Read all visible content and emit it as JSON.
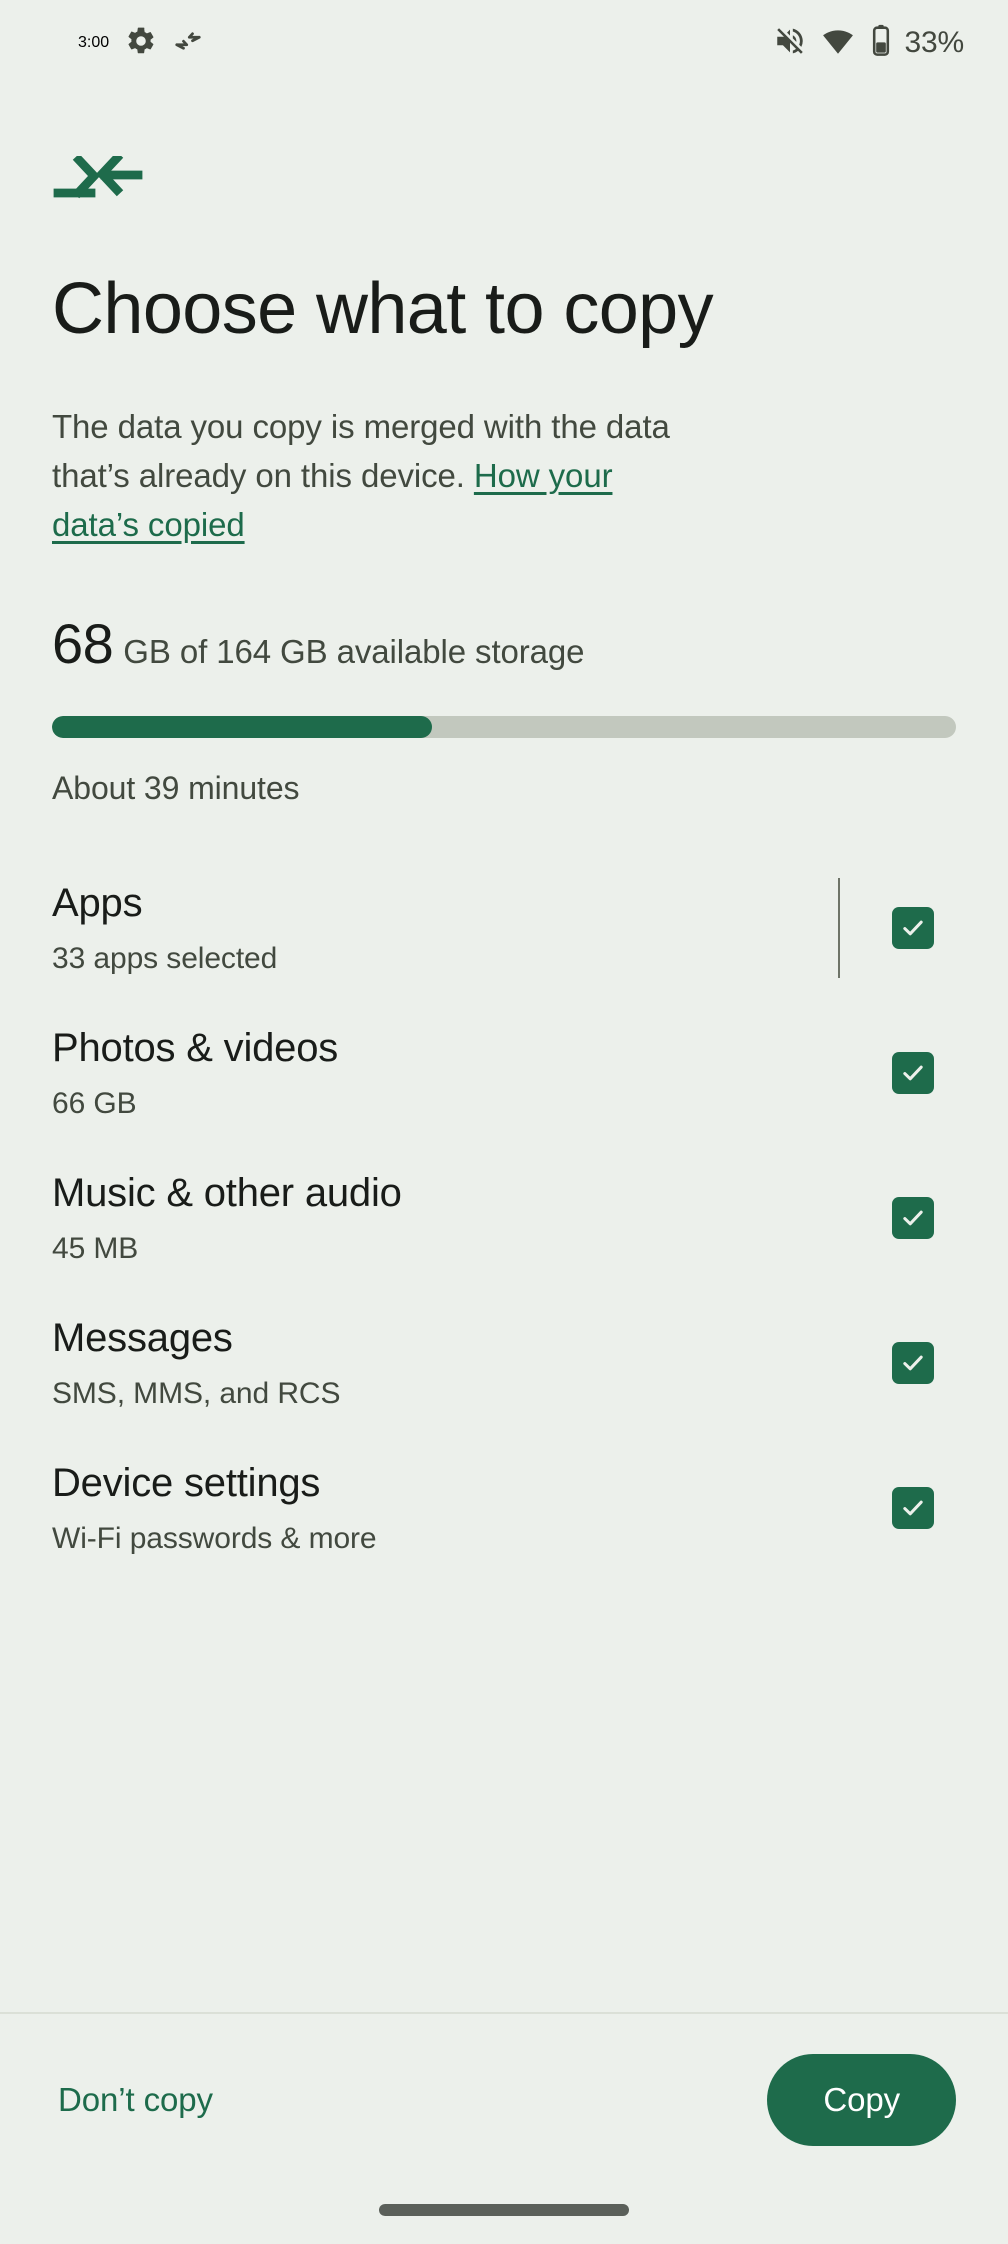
{
  "status_bar": {
    "time": "3:00",
    "left_icons": [
      "gear-icon",
      "data-transfer-icon"
    ],
    "right_icons": [
      "volume-off-icon",
      "wifi-icon",
      "battery-icon"
    ],
    "battery_percent": "33%"
  },
  "brand": {
    "icon": "data-transfer-icon",
    "color": "#1E6B4B"
  },
  "page": {
    "title": "Choose what to copy",
    "description_before_link": "The data you copy is merged with the data that’s already on this device. ",
    "description_link": "How your data’s copied"
  },
  "storage": {
    "available_value": "68",
    "available_rest": "GB of 164 GB available storage",
    "progress_percent": 42,
    "eta": "About 39 minutes"
  },
  "items": [
    {
      "title": "Apps",
      "subtitle": "33 apps selected",
      "checked": true,
      "has_divider": true
    },
    {
      "title": "Photos & videos",
      "subtitle": "66 GB",
      "checked": true,
      "has_divider": false
    },
    {
      "title": "Music & other audio",
      "subtitle": "45 MB",
      "checked": true,
      "has_divider": false
    },
    {
      "title": "Messages",
      "subtitle": "SMS, MMS, and RCS",
      "checked": true,
      "has_divider": false
    },
    {
      "title": "Device settings",
      "subtitle": "Wi-Fi passwords & more",
      "checked": true,
      "has_divider": false
    }
  ],
  "bottom_bar": {
    "secondary_label": "Don’t copy",
    "primary_label": "Copy"
  },
  "colors": {
    "background": "#ECF0EB",
    "accent_green": "#1E6B4B",
    "link_green": "#1D6B4B",
    "text_primary": "#191C19",
    "text_secondary": "#42493F",
    "track_grey": "#C2C8BE"
  }
}
